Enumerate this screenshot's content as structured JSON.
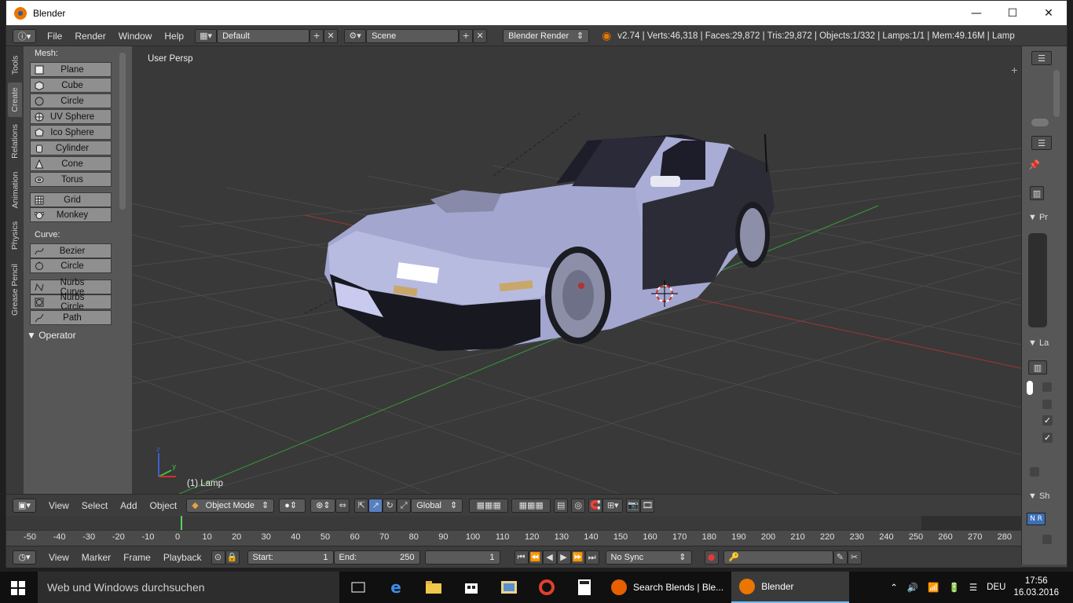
{
  "window": {
    "title": "Blender"
  },
  "info_header": {
    "menus": [
      "File",
      "Render",
      "Window",
      "Help"
    ],
    "screen_layout": "Default",
    "scene": "Scene",
    "render_engine": "Blender Render",
    "stats": "v2.74 | Verts:46,318 | Faces:29,872 | Tris:29,872 | Objects:1/332 | Lamps:1/1 | Mem:49.16M | Lamp"
  },
  "tabs": [
    "Tools",
    "Create",
    "Relations",
    "Animation",
    "Physics",
    "Grease Pencil"
  ],
  "toolshelf": {
    "mesh_label": "Mesh:",
    "mesh_items": [
      "Plane",
      "Cube",
      "Circle",
      "UV Sphere",
      "Ico Sphere",
      "Cylinder",
      "Cone",
      "Torus"
    ],
    "extra_items": [
      "Grid",
      "Monkey"
    ],
    "curve_label": "Curve:",
    "curve_items": [
      "Bezier",
      "Circle"
    ],
    "nurbs_items": [
      "Nurbs Curve",
      "Nurbs Circle",
      "Path"
    ],
    "operator": "Operator"
  },
  "viewport": {
    "view_label": "User Persp",
    "object_label": "(1) Lamp"
  },
  "properties": {
    "labels": [
      "Pr",
      "La",
      "Sh"
    ]
  },
  "view3d_header": {
    "menus": [
      "View",
      "Select",
      "Add",
      "Object"
    ],
    "mode": "Object Mode",
    "orientation": "Global"
  },
  "timeline": {
    "ticks": [
      "-50",
      "-40",
      "-30",
      "-20",
      "-10",
      "0",
      "10",
      "20",
      "30",
      "40",
      "50",
      "60",
      "70",
      "80",
      "90",
      "100",
      "110",
      "120",
      "130",
      "140",
      "150",
      "160",
      "170",
      "180",
      "190",
      "200",
      "210",
      "220",
      "230",
      "240",
      "250",
      "260",
      "270",
      "280"
    ],
    "current_frame": 1,
    "menus": [
      "View",
      "Marker",
      "Frame",
      "Playback"
    ],
    "start_label": "Start:",
    "start_value": "1",
    "end_label": "End:",
    "end_value": "250",
    "current_value": "1",
    "sync": "No Sync"
  },
  "taskbar": {
    "search_placeholder": "Web und Windows durchsuchen",
    "apps": [
      "Search Blends | Ble...",
      "Blender"
    ],
    "language": "DEU",
    "time": "17:56",
    "date": "16.03.2016"
  },
  "colors": {
    "accent_orange": "#ea7600",
    "grid_x_red": "#b03030",
    "grid_y_green": "#3c9a3c",
    "car_body": "#a3a6cf",
    "frame_marker": "#5ad35a"
  }
}
